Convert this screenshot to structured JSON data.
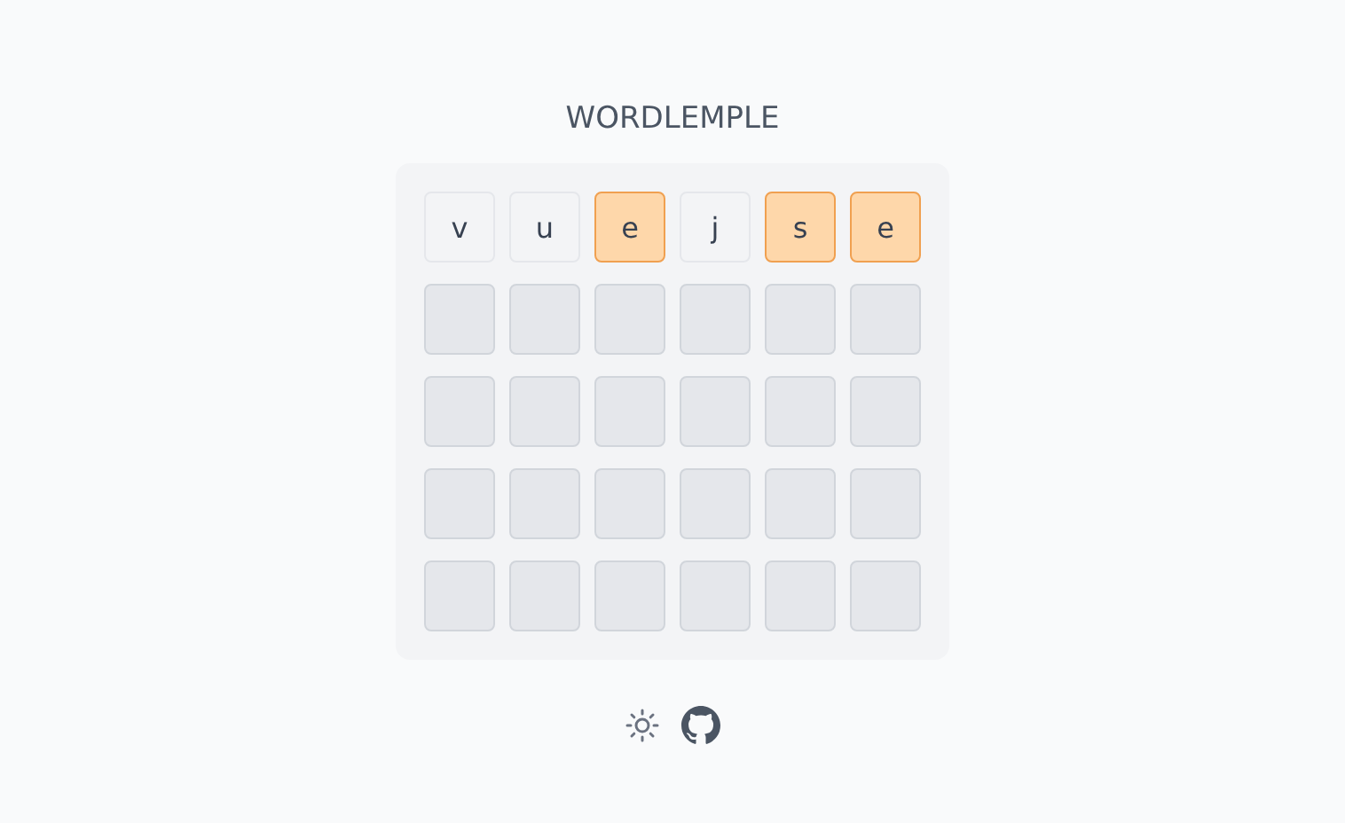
{
  "title": "WORDLEMPLE",
  "rows": [
    {
      "tiles": [
        {
          "letter": "v",
          "kind": "absent"
        },
        {
          "letter": "u",
          "kind": "absent"
        },
        {
          "letter": "e",
          "kind": "present"
        },
        {
          "letter": "j",
          "kind": "absent"
        },
        {
          "letter": "s",
          "kind": "present"
        },
        {
          "letter": "e",
          "kind": "present"
        }
      ]
    },
    {
      "tiles": [
        {
          "kind": "empty"
        },
        {
          "kind": "empty"
        },
        {
          "kind": "empty"
        },
        {
          "kind": "empty"
        },
        {
          "kind": "empty"
        },
        {
          "kind": "empty"
        }
      ]
    },
    {
      "tiles": [
        {
          "kind": "empty"
        },
        {
          "kind": "empty"
        },
        {
          "kind": "empty"
        },
        {
          "kind": "empty"
        },
        {
          "kind": "empty"
        },
        {
          "kind": "empty"
        }
      ]
    },
    {
      "tiles": [
        {
          "kind": "empty"
        },
        {
          "kind": "empty"
        },
        {
          "kind": "empty"
        },
        {
          "kind": "empty"
        },
        {
          "kind": "empty"
        },
        {
          "kind": "empty"
        }
      ]
    },
    {
      "tiles": [
        {
          "kind": "empty"
        },
        {
          "kind": "empty"
        },
        {
          "kind": "empty"
        },
        {
          "kind": "empty"
        },
        {
          "kind": "empty"
        },
        {
          "kind": "empty"
        }
      ]
    }
  ]
}
